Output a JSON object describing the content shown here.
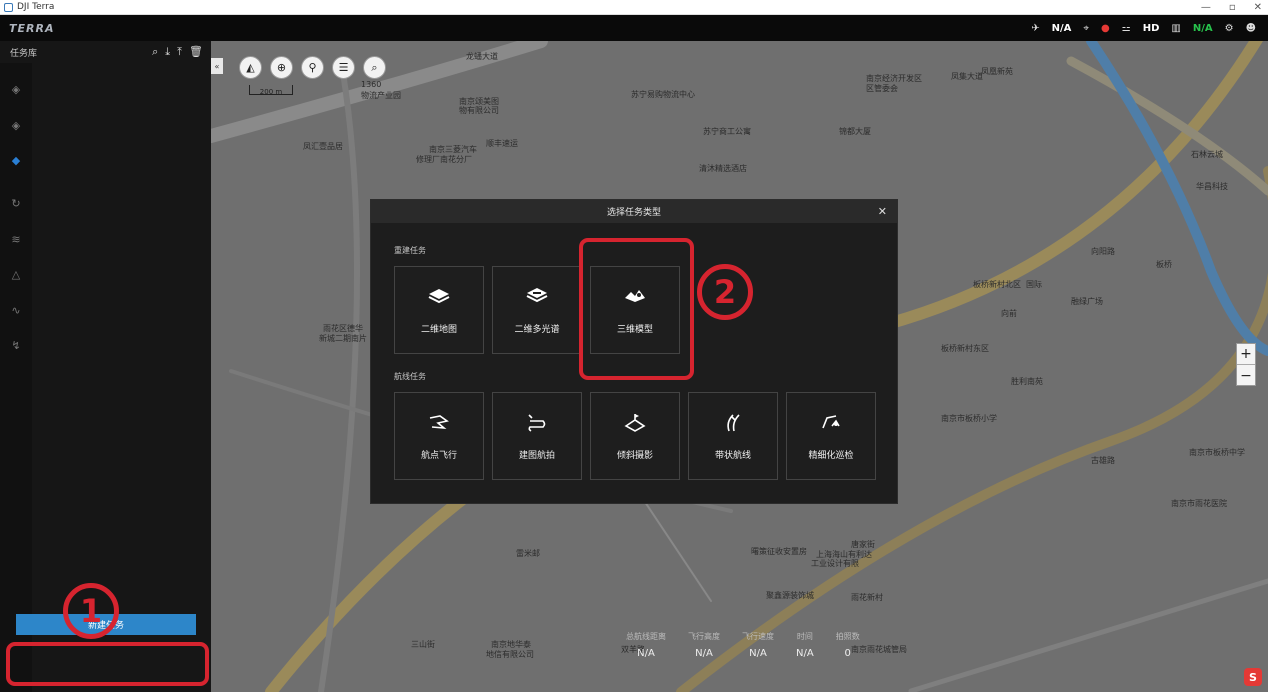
{
  "window": {
    "title": "DJI Terra"
  },
  "appbar": {
    "brand": "TERRA",
    "status": {
      "drone": "N/A",
      "hd": "HD",
      "signal": "N/A"
    }
  },
  "sidebar": {
    "title": "任务库",
    "new_task_label": "新建任务"
  },
  "map": {
    "scale_label": "200 m",
    "labels": [
      "1360",
      "物流产业园",
      "龙蟠大道",
      "南京颂美图",
      "物有限公司",
      "苏宁易购物流中心",
      "南京经济开发区",
      "区管委会",
      "凤集大道",
      "凤凰新苑",
      "南京三菱汽车",
      "修理厂南花分厂",
      "凤汇壹品居",
      "顺丰速运",
      "苏宁商工公寓",
      "锦都大厦",
      "清沐精选酒店",
      "石林云城",
      "华昌科技",
      "向阳路",
      "板桥",
      "板桥新村北区",
      "国际",
      "融绿广场",
      "向前",
      "板桥新村东区",
      "胜利南苑",
      "雨花区德华",
      "新城二期南片",
      "南京市板桥小学",
      "古雄路",
      "南京市板桥中学",
      "南京市雨花医院",
      "唐家街",
      "雷米邮",
      "南京地华泰",
      "地信有限公司",
      "曙策征收安置房",
      "上海海山有利达",
      "工业设计有限",
      "聚鑫源装饰城",
      "雨花新村",
      "南京雨花城管局",
      "双羊路",
      "三山街"
    ],
    "stats": [
      {
        "label": "总航线距离",
        "value": "N/A"
      },
      {
        "label": "飞行高度",
        "value": "N/A"
      },
      {
        "label": "飞行速度",
        "value": "N/A"
      },
      {
        "label": "时间",
        "value": "N/A"
      },
      {
        "label": "拍照数",
        "value": "0"
      }
    ]
  },
  "dialog": {
    "title": "选择任务类型",
    "section_rebuild": "重建任务",
    "section_route": "航线任务",
    "rebuild_cards": [
      "二维地图",
      "二维多光谱",
      "三维模型"
    ],
    "route_cards": [
      "航点飞行",
      "建图航拍",
      "倾斜摄影",
      "带状航线",
      "精细化巡检"
    ]
  },
  "annotations": {
    "step1": "1",
    "step2": "2",
    "color": "#d6242f"
  },
  "colors": {
    "accent": "#2d86c9",
    "brand": "#aeb4bd"
  }
}
